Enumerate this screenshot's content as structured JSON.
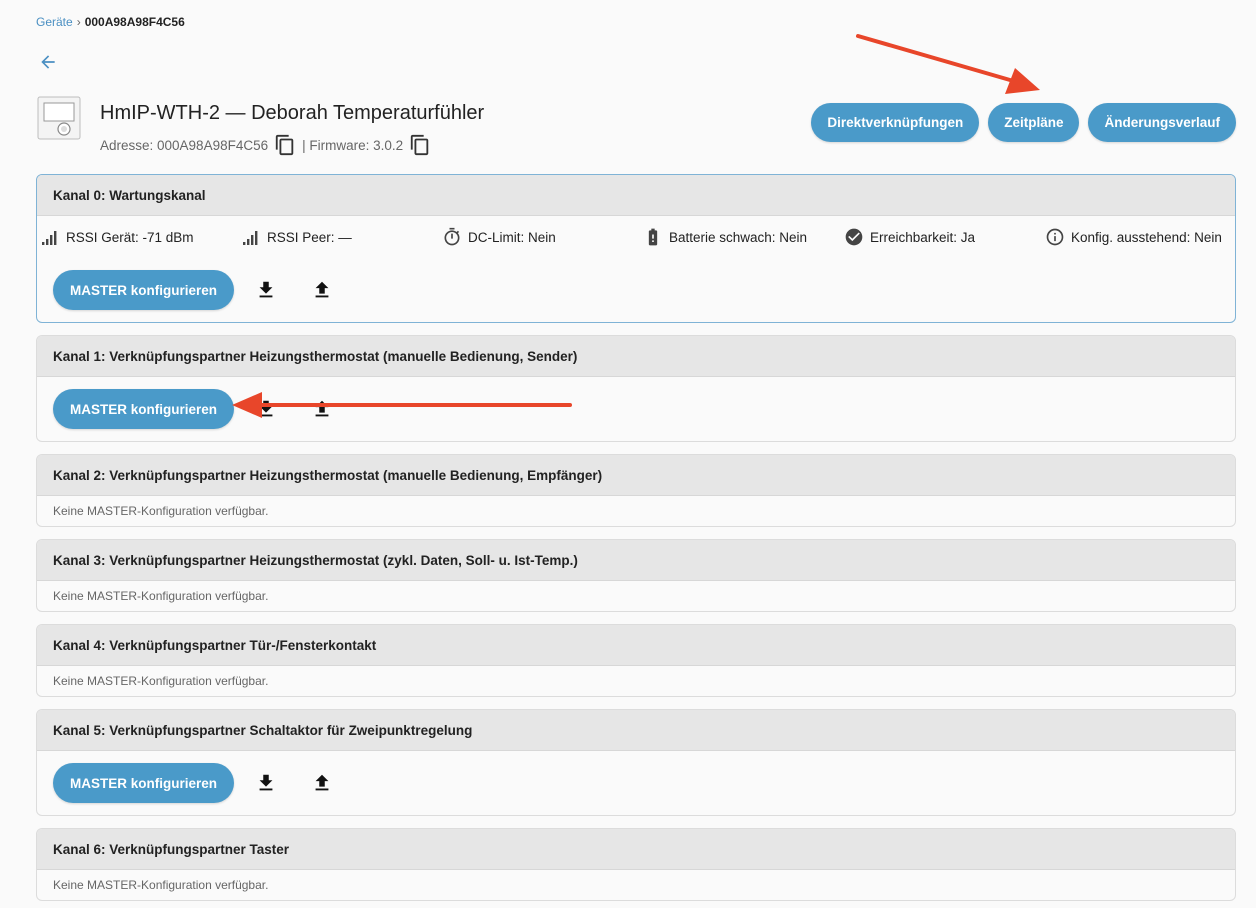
{
  "breadcrumb": {
    "parent": "Geräte",
    "separator": "›",
    "current": "000A98A98F4C56"
  },
  "device": {
    "title": "HmIP-WTH-2 — Deborah Temperaturfühler",
    "address_label": "Adresse: 000A98A98F4C56",
    "firmware_label": "| Firmware: 3.0.2"
  },
  "header_actions": {
    "direct_links": "Direktverknüpfungen",
    "schedules": "Zeitpläne",
    "history": "Änderungsverlauf"
  },
  "status": {
    "rssi_device": "RSSI Gerät: -71 dBm",
    "rssi_peer": "RSSI Peer: —",
    "dc_limit": "DC-Limit: Nein",
    "battery_low": "Batterie schwach: Nein",
    "reachability": "Erreichbarkeit: Ja",
    "config_pending": "Konfig. ausstehend: Nein"
  },
  "master_button_label": "MASTER konfigurieren",
  "empty_label": "Keine MASTER-Konfiguration verfügbar.",
  "channels": [
    {
      "title": "Kanal 0: Wartungskanal"
    },
    {
      "title": "Kanal 1: Verknüpfungspartner Heizungsthermostat (manuelle Bedienung, Sender)"
    },
    {
      "title": "Kanal 2: Verknüpfungspartner Heizungsthermostat (manuelle Bedienung, Empfänger)"
    },
    {
      "title": "Kanal 3: Verknüpfungspartner Heizungsthermostat (zykl. Daten, Soll- u. Ist-Temp.)"
    },
    {
      "title": "Kanal 4: Verknüpfungspartner Tür-/Fensterkontakt"
    },
    {
      "title": "Kanal 5: Verknüpfungspartner Schaltaktor für Zweipunktregelung"
    },
    {
      "title": "Kanal 6: Verknüpfungspartner Taster"
    }
  ],
  "colors": {
    "accent": "#4a9ac9",
    "annotation": "#e8462a"
  },
  "icons": [
    "back-arrow-icon",
    "copy-icon",
    "signal-icon",
    "timer-icon",
    "battery-icon",
    "check-circle-icon",
    "info-icon",
    "download-icon",
    "upload-icon"
  ]
}
